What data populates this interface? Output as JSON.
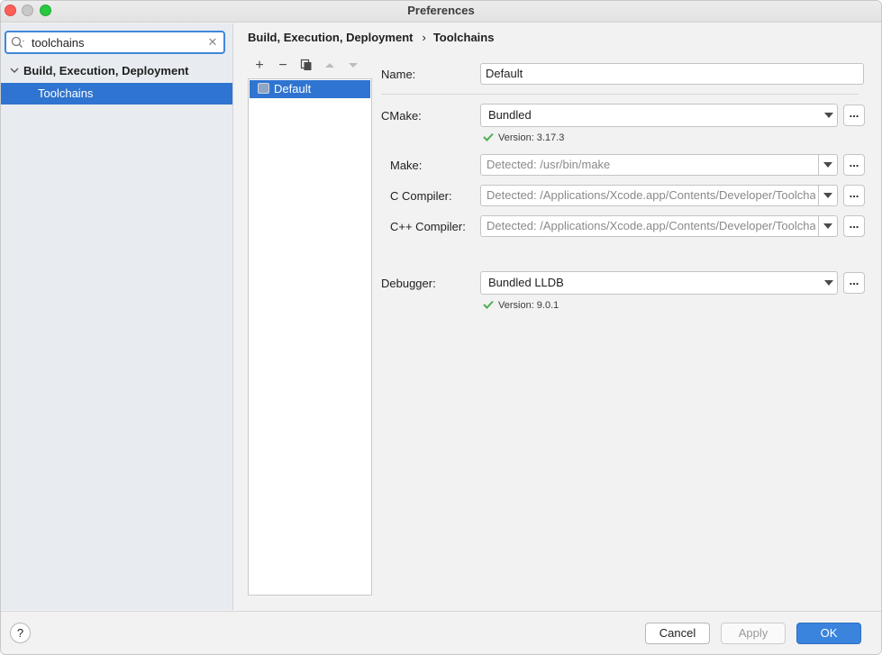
{
  "window": {
    "title": "Preferences"
  },
  "sidebar": {
    "search": {
      "value": "toolchains"
    },
    "tree": {
      "parent_label": "Build, Execution, Deployment",
      "child_label": "Toolchains"
    }
  },
  "breadcrumb": {
    "section": "Build, Execution, Deployment",
    "separator": "›",
    "page": "Toolchains"
  },
  "toolchains": {
    "toolbar": {
      "add": "+",
      "remove": "−",
      "copy_icon": "copy-icon",
      "up_icon": "move-up-icon",
      "down_icon": "move-down-icon"
    },
    "items": [
      "Default"
    ]
  },
  "form": {
    "name": {
      "label": "Name:",
      "value": "Default"
    },
    "cmake": {
      "label": "CMake:",
      "value": "Bundled",
      "version": "Version: 3.17.3"
    },
    "make": {
      "label": "Make:",
      "value": "Detected: /usr/bin/make"
    },
    "c_compiler": {
      "label": "C Compiler:",
      "value": "Detected: /Applications/Xcode.app/Contents/Developer/Toolchains/XcodeDefault.xctoolchain/usr/bin/cc"
    },
    "cpp_compiler": {
      "label": "C++ Compiler:",
      "value": "Detected: /Applications/Xcode.app/Contents/Developer/Toolchains/XcodeDefault.xctoolchain/usr/bin/c++"
    },
    "debugger": {
      "label": "Debugger:",
      "value": "Bundled LLDB",
      "version": "Version: 9.0.1"
    },
    "browse_label": "..."
  },
  "footer": {
    "help_label": "?",
    "cancel_label": "Cancel",
    "apply_label": "Apply",
    "ok_label": "OK"
  },
  "colors": {
    "selection": "#2f74d0",
    "ok_button": "#3a84de",
    "check_green": "#4caf50"
  }
}
